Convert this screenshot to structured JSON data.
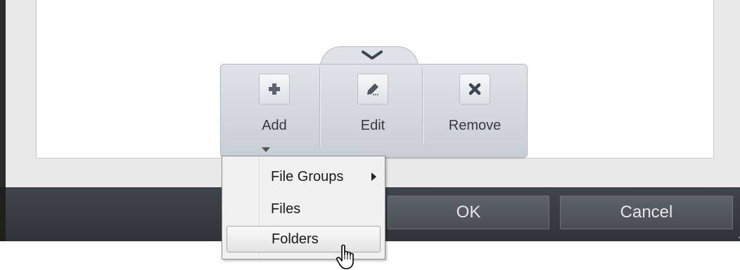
{
  "toolbar": {
    "items": [
      {
        "label": "Add",
        "icon": "plus-icon"
      },
      {
        "label": "Edit",
        "icon": "pencil-icon"
      },
      {
        "label": "Remove",
        "icon": "x-icon"
      }
    ],
    "collapse_icon": "chevron-down-icon"
  },
  "menu": {
    "items": [
      {
        "label": "File Groups",
        "has_submenu": true
      },
      {
        "label": "Files"
      },
      {
        "label": "Folders",
        "highlighted": true
      }
    ]
  },
  "dialog": {
    "ok_label": "OK",
    "cancel_label": "Cancel"
  },
  "colors": {
    "bottom_bar": "#3a3f45",
    "toolbar_bg": "#dfe3e8"
  }
}
